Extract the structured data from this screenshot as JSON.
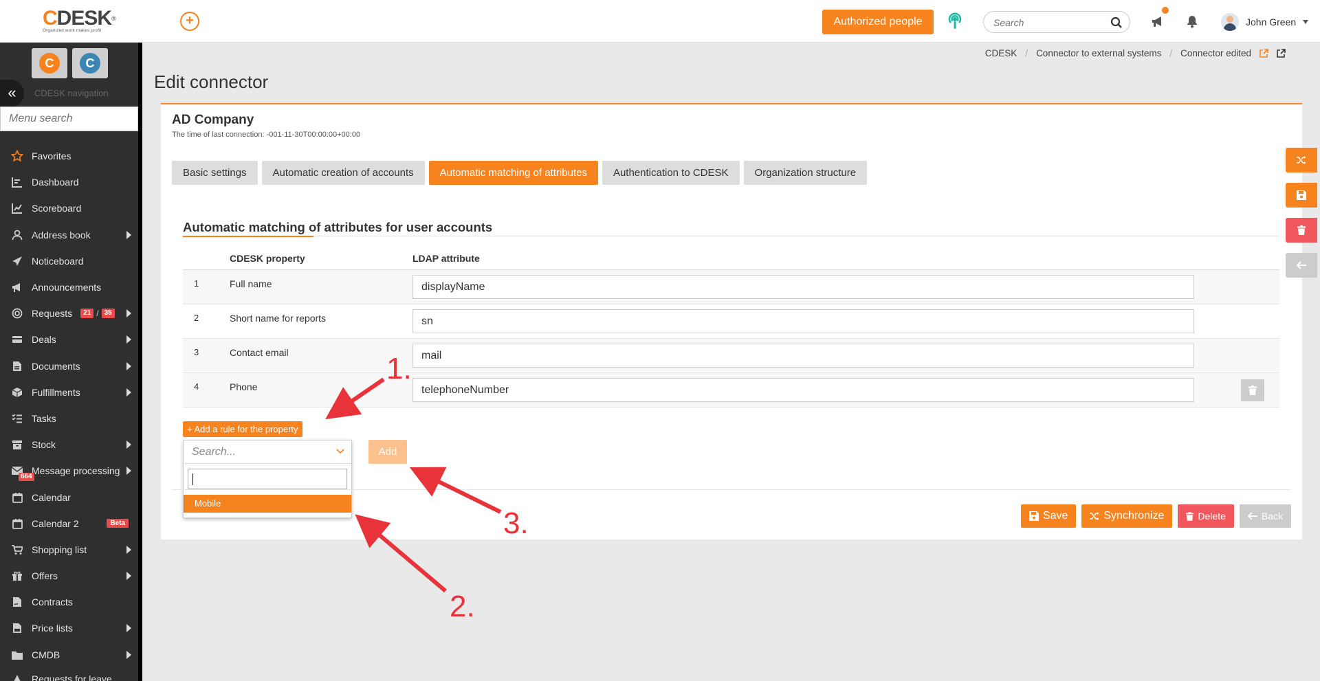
{
  "header": {
    "logo_text": "CDESK",
    "logo_reg": "®",
    "logo_tagline": "Organized work makes profit",
    "authorized_label": "Authorized people",
    "search_placeholder": "Search",
    "user_name": "John Green"
  },
  "sidebar": {
    "nav_label": "CDESK navigation",
    "search_placeholder": "Menu search",
    "items": [
      {
        "label": "Favorites"
      },
      {
        "label": "Dashboard"
      },
      {
        "label": "Scoreboard"
      },
      {
        "label": "Address book"
      },
      {
        "label": "Noticeboard"
      },
      {
        "label": "Announcements"
      },
      {
        "label": "Requests",
        "badge1": "21",
        "badge_sep": "/",
        "badge2": "35"
      },
      {
        "label": "Deals"
      },
      {
        "label": "Documents"
      },
      {
        "label": "Fulfillments"
      },
      {
        "label": "Tasks"
      },
      {
        "label": "Stock"
      },
      {
        "label": "Message processing",
        "badge": "664"
      },
      {
        "label": "Calendar"
      },
      {
        "label": "Calendar 2",
        "tag": "Beta"
      },
      {
        "label": "Shopping list"
      },
      {
        "label": "Offers"
      },
      {
        "label": "Contracts"
      },
      {
        "label": "Price lists"
      },
      {
        "label": "CMDB"
      },
      {
        "label": "Requests for leave"
      }
    ]
  },
  "breadcrumb": [
    "CDESK",
    "Connector to external systems",
    "Connector edited"
  ],
  "page_title": "Edit connector",
  "card": {
    "title": "AD Company",
    "subtitle": "The time of last connection: -001-11-30T00:00:00+00:00",
    "tabs": [
      {
        "label": "Basic settings"
      },
      {
        "label": "Automatic creation of accounts"
      },
      {
        "label": "Automatic matching of attributes"
      },
      {
        "label": "Authentication to CDESK"
      },
      {
        "label": "Organization structure"
      }
    ],
    "section_title": "Automatic matching of attributes for user accounts",
    "columns": {
      "property": "CDESK property",
      "ldap": "LDAP attribute"
    },
    "rows": [
      {
        "num": "1",
        "property": "Full name",
        "ldap": "displayName"
      },
      {
        "num": "2",
        "property": "Short name for reports",
        "ldap": "sn"
      },
      {
        "num": "3",
        "property": "Contact email",
        "ldap": "mail"
      },
      {
        "num": "4",
        "property": "Phone",
        "ldap": "telephoneNumber"
      }
    ],
    "add_rule_label": "+ Add a rule for the property",
    "dropdown_placeholder": "Search...",
    "dropdown_option": "Mobile",
    "add_label": "Add",
    "actions": {
      "save": "Save",
      "sync": "Synchronize",
      "delete": "Delete",
      "back": "Back"
    }
  },
  "annotations": [
    "1.",
    "2.",
    "3."
  ],
  "colors": {
    "accent": "#f7831e",
    "danger": "#f0585e",
    "annotation": "#e8333a",
    "sidebar": "#2f2f2f"
  }
}
